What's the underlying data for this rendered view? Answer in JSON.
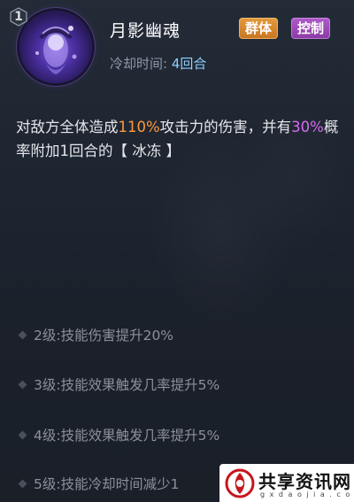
{
  "skill": {
    "level": "1",
    "name": "月影幽魂",
    "cooldown_label": "冷却时间: ",
    "cooldown_value": "4回合",
    "tags": [
      {
        "label": "群体",
        "color": "#d98a34"
      },
      {
        "label": "控制",
        "color": "#9c49b8"
      }
    ],
    "icon": "moon-ghost-icon"
  },
  "description": {
    "part1": "对敌方全体造成",
    "damage_pct": "110%",
    "part2": "攻击力的伤害，并有",
    "chance_pct": "30%",
    "part3": "概率附加1回合的【 冰冻 】"
  },
  "upgrades": [
    "2级:技能伤害提升20%",
    "3级:技能效果触发几率提升5%",
    "4级:技能效果触发几率提升5%",
    "5级:技能冷却时间减少1"
  ],
  "watermark": {
    "title": "共享资讯网",
    "subtitle": "g x d a o j i a . c o m"
  },
  "colors": {
    "highlight_orange": "#ff9a3c",
    "highlight_purple": "#d56cf0",
    "cooldown_value": "#8fd0ff"
  }
}
